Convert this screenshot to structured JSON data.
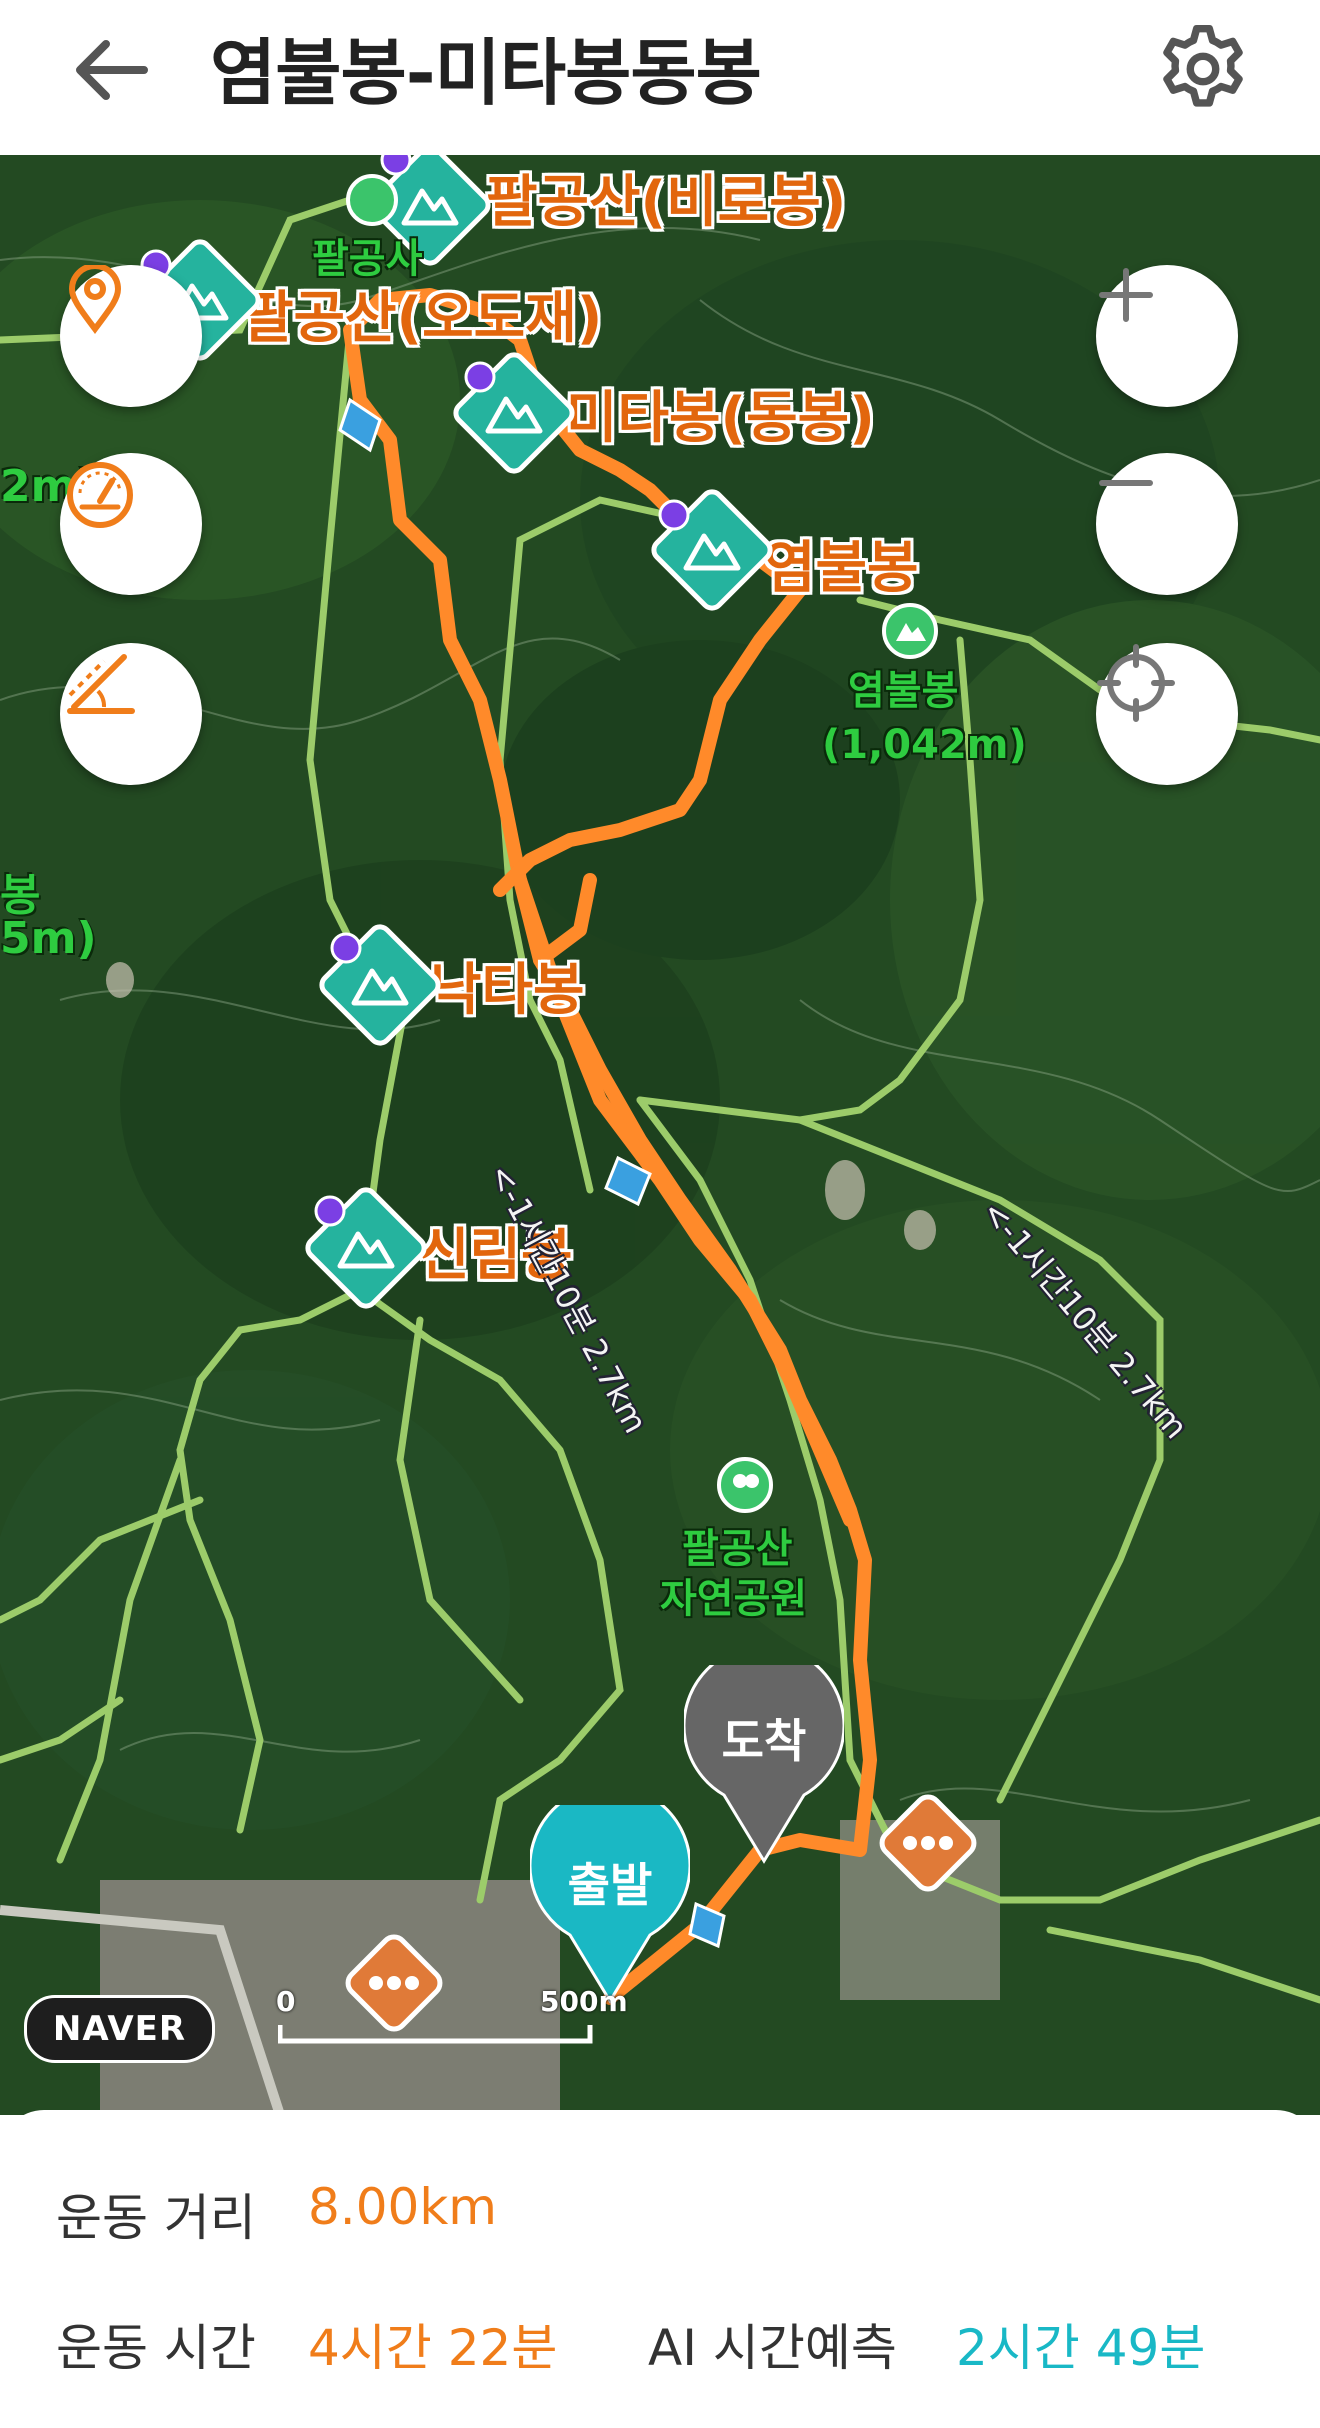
{
  "header": {
    "title": "염불봉-미타봉동봉"
  },
  "map": {
    "peaks": [
      {
        "name": "팔공산(비로봉)"
      },
      {
        "name": "팔공산(오도재)"
      },
      {
        "name": "미타봉(동봉)"
      },
      {
        "name": "염불봉"
      },
      {
        "name": "낙타봉"
      },
      {
        "name": "신림봉"
      }
    ],
    "labels": {
      "temple": "팔공사",
      "yeombul_name": "염불봉",
      "yeombul_alt": "(1,042m)",
      "park_line1": "팔공산",
      "park_line2": "자연공원",
      "left_edge_1": "2m)",
      "left_edge_2": "봉",
      "left_edge_3": "5m)"
    },
    "trails": [
      {
        "label": "<-1시간10분 2.7km"
      },
      {
        "label": "<-1시간10분 2.7km"
      }
    ],
    "markers": {
      "arrival": "도착",
      "departure": "출발"
    },
    "attribution": "NAVER",
    "scale": {
      "start": "0",
      "end": "500m"
    }
  },
  "stats": {
    "distance_label": "운동 거리",
    "distance_value": "8.00km",
    "time_label": "운동 시간",
    "time_value": "4시간 22분",
    "ai_label": "AI 시간예측",
    "ai_value": "2시간 49분"
  },
  "colors": {
    "route": "#ff8a2a",
    "peak_label": "#e2660d",
    "peak_icon": "#25b39e",
    "trail": "#9ccc6a",
    "accent_teal": "#19b8c6",
    "accent_orange": "#f07d1a",
    "arrival_pin": "#666666",
    "departure_pin": "#1ab8c4"
  },
  "icons": [
    "back-arrow-icon",
    "gear-icon",
    "location-pin-icon",
    "speedometer-icon",
    "slope-icon",
    "zoom-in-icon",
    "zoom-out-icon",
    "locate-icon",
    "peak-icon",
    "dots-icon"
  ]
}
